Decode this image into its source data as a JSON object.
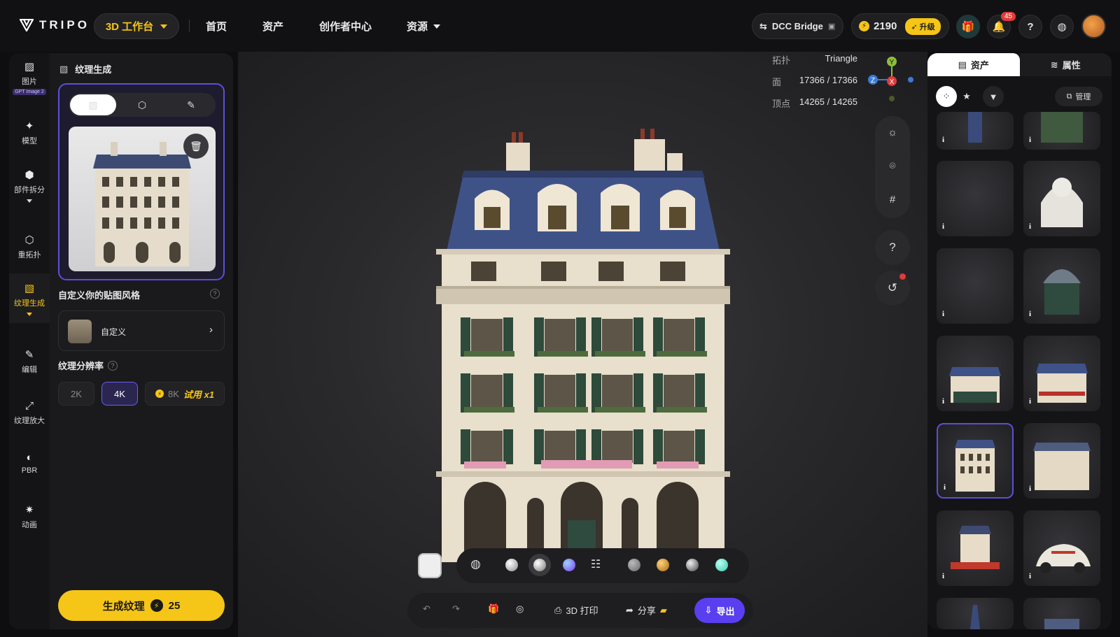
{
  "brand": {
    "name": "TRIPO"
  },
  "topbar": {
    "workbench": "3D 工作台",
    "nav": [
      "首页",
      "资产",
      "创作者中心",
      "资源"
    ],
    "dcc_bridge": "DCC Bridge",
    "credits": "2190",
    "upgrade": "升级",
    "notification_count": "45"
  },
  "rail": {
    "items": [
      {
        "label": "图片",
        "badge": "GPT Image 2"
      },
      {
        "label": "模型"
      },
      {
        "label": "部件拆分"
      },
      {
        "label": "重拓扑"
      },
      {
        "label": "纹理生成"
      },
      {
        "label": "编辑"
      },
      {
        "label": "纹理放大"
      },
      {
        "label": "PBR"
      },
      {
        "label": "动画"
      }
    ]
  },
  "panel": {
    "title": "纹理生成",
    "style_label": "自定义你的贴图风格",
    "style_value": "自定义",
    "resolution_label": "纹理分辨率",
    "resolutions": [
      "2K",
      "4K",
      "8K"
    ],
    "trial": "试用 x1",
    "generate": "生成纹理",
    "cost": "25"
  },
  "stats": {
    "topology_label": "拓扑",
    "topology_value": "Triangle",
    "faces_label": "面",
    "faces_value": "17366 / 17366",
    "verts_label": "顶点",
    "verts_value": "14265 / 14265"
  },
  "gizmo": {
    "y": "Y",
    "z": "Z",
    "x": "X"
  },
  "bottom_bar": {
    "print": "3D 打印",
    "share": "分享",
    "export": "导出"
  },
  "right_panel": {
    "tab_assets": "资产",
    "tab_props": "属性",
    "manage": "管理"
  },
  "colors": {
    "accent": "#f5c518",
    "primary": "#5a3ff0",
    "selection": "#5b4fd8"
  }
}
